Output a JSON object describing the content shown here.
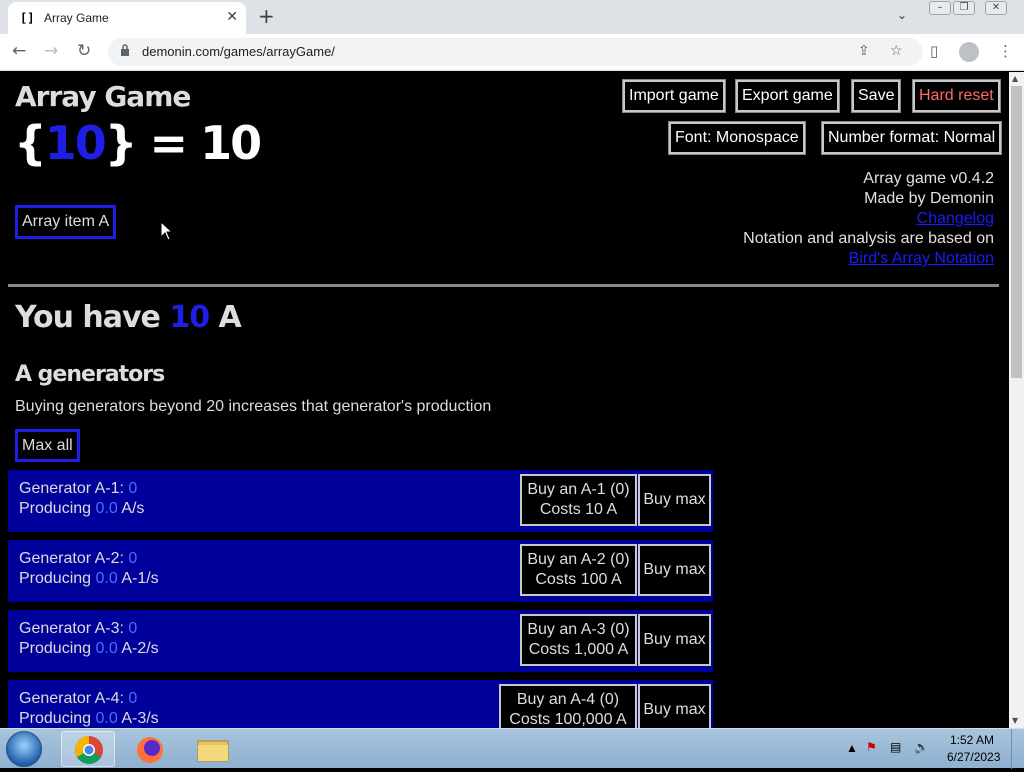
{
  "browser": {
    "tab_favicon": "[]",
    "tab_title": "Array Game",
    "tab_close": "✕",
    "new_tab": "+",
    "url": "demonin.com/games/arrayGame/"
  },
  "game": {
    "title": "Array Game",
    "array_open": "{",
    "array_value": "10",
    "array_close": "}",
    "array_equals": "= 10",
    "array_item_button": "Array item A",
    "top_buttons": {
      "import": "Import game",
      "export": "Export game",
      "save": "Save",
      "hard_reset": "Hard reset",
      "font": "Font: Monospace",
      "number_format": "Number format: Normal"
    },
    "info": {
      "version": "Array game v0.4.2",
      "author": "Made by Demonin",
      "changelog": "Changelog",
      "notation_text": "Notation and analysis are based on",
      "notation_link": "Bird's Array Notation"
    },
    "you_have_prefix": "You have",
    "you_have_amount": "10",
    "you_have_unit": "A",
    "generators_title": "A generators",
    "generators_desc": "Buying generators beyond 20 increases that generator's production",
    "max_all": "Max all",
    "generators": [
      {
        "name": "Generator A-1:",
        "count": "0",
        "producing_label": "Producing",
        "rate": "0.0",
        "rate_unit": "A/s",
        "buy_line1": "Buy an A-1 (0)",
        "buy_line2": "Costs 10 A",
        "buy_max": "Buy max"
      },
      {
        "name": "Generator A-2:",
        "count": "0",
        "producing_label": "Producing",
        "rate": "0.0",
        "rate_unit": "A-1/s",
        "buy_line1": "Buy an A-2 (0)",
        "buy_line2": "Costs 100 A",
        "buy_max": "Buy max"
      },
      {
        "name": "Generator A-3:",
        "count": "0",
        "producing_label": "Producing",
        "rate": "0.0",
        "rate_unit": "A-2/s",
        "buy_line1": "Buy an A-3 (0)",
        "buy_line2": "Costs 1,000 A",
        "buy_max": "Buy max"
      },
      {
        "name": "Generator A-4:",
        "count": "0",
        "producing_label": "Producing",
        "rate": "0.0",
        "rate_unit": "A-3/s",
        "buy_line1": "Buy an A-4 (0)",
        "buy_line2": "Costs 100,000 A",
        "buy_max": "Buy max"
      }
    ]
  },
  "taskbar": {
    "time": "1:52 AM",
    "date": "6/27/2023"
  },
  "colors": {
    "accent_blue": "#1e1ee6",
    "generator_row": "#00009a",
    "hard_reset": "#ff6a6a"
  }
}
